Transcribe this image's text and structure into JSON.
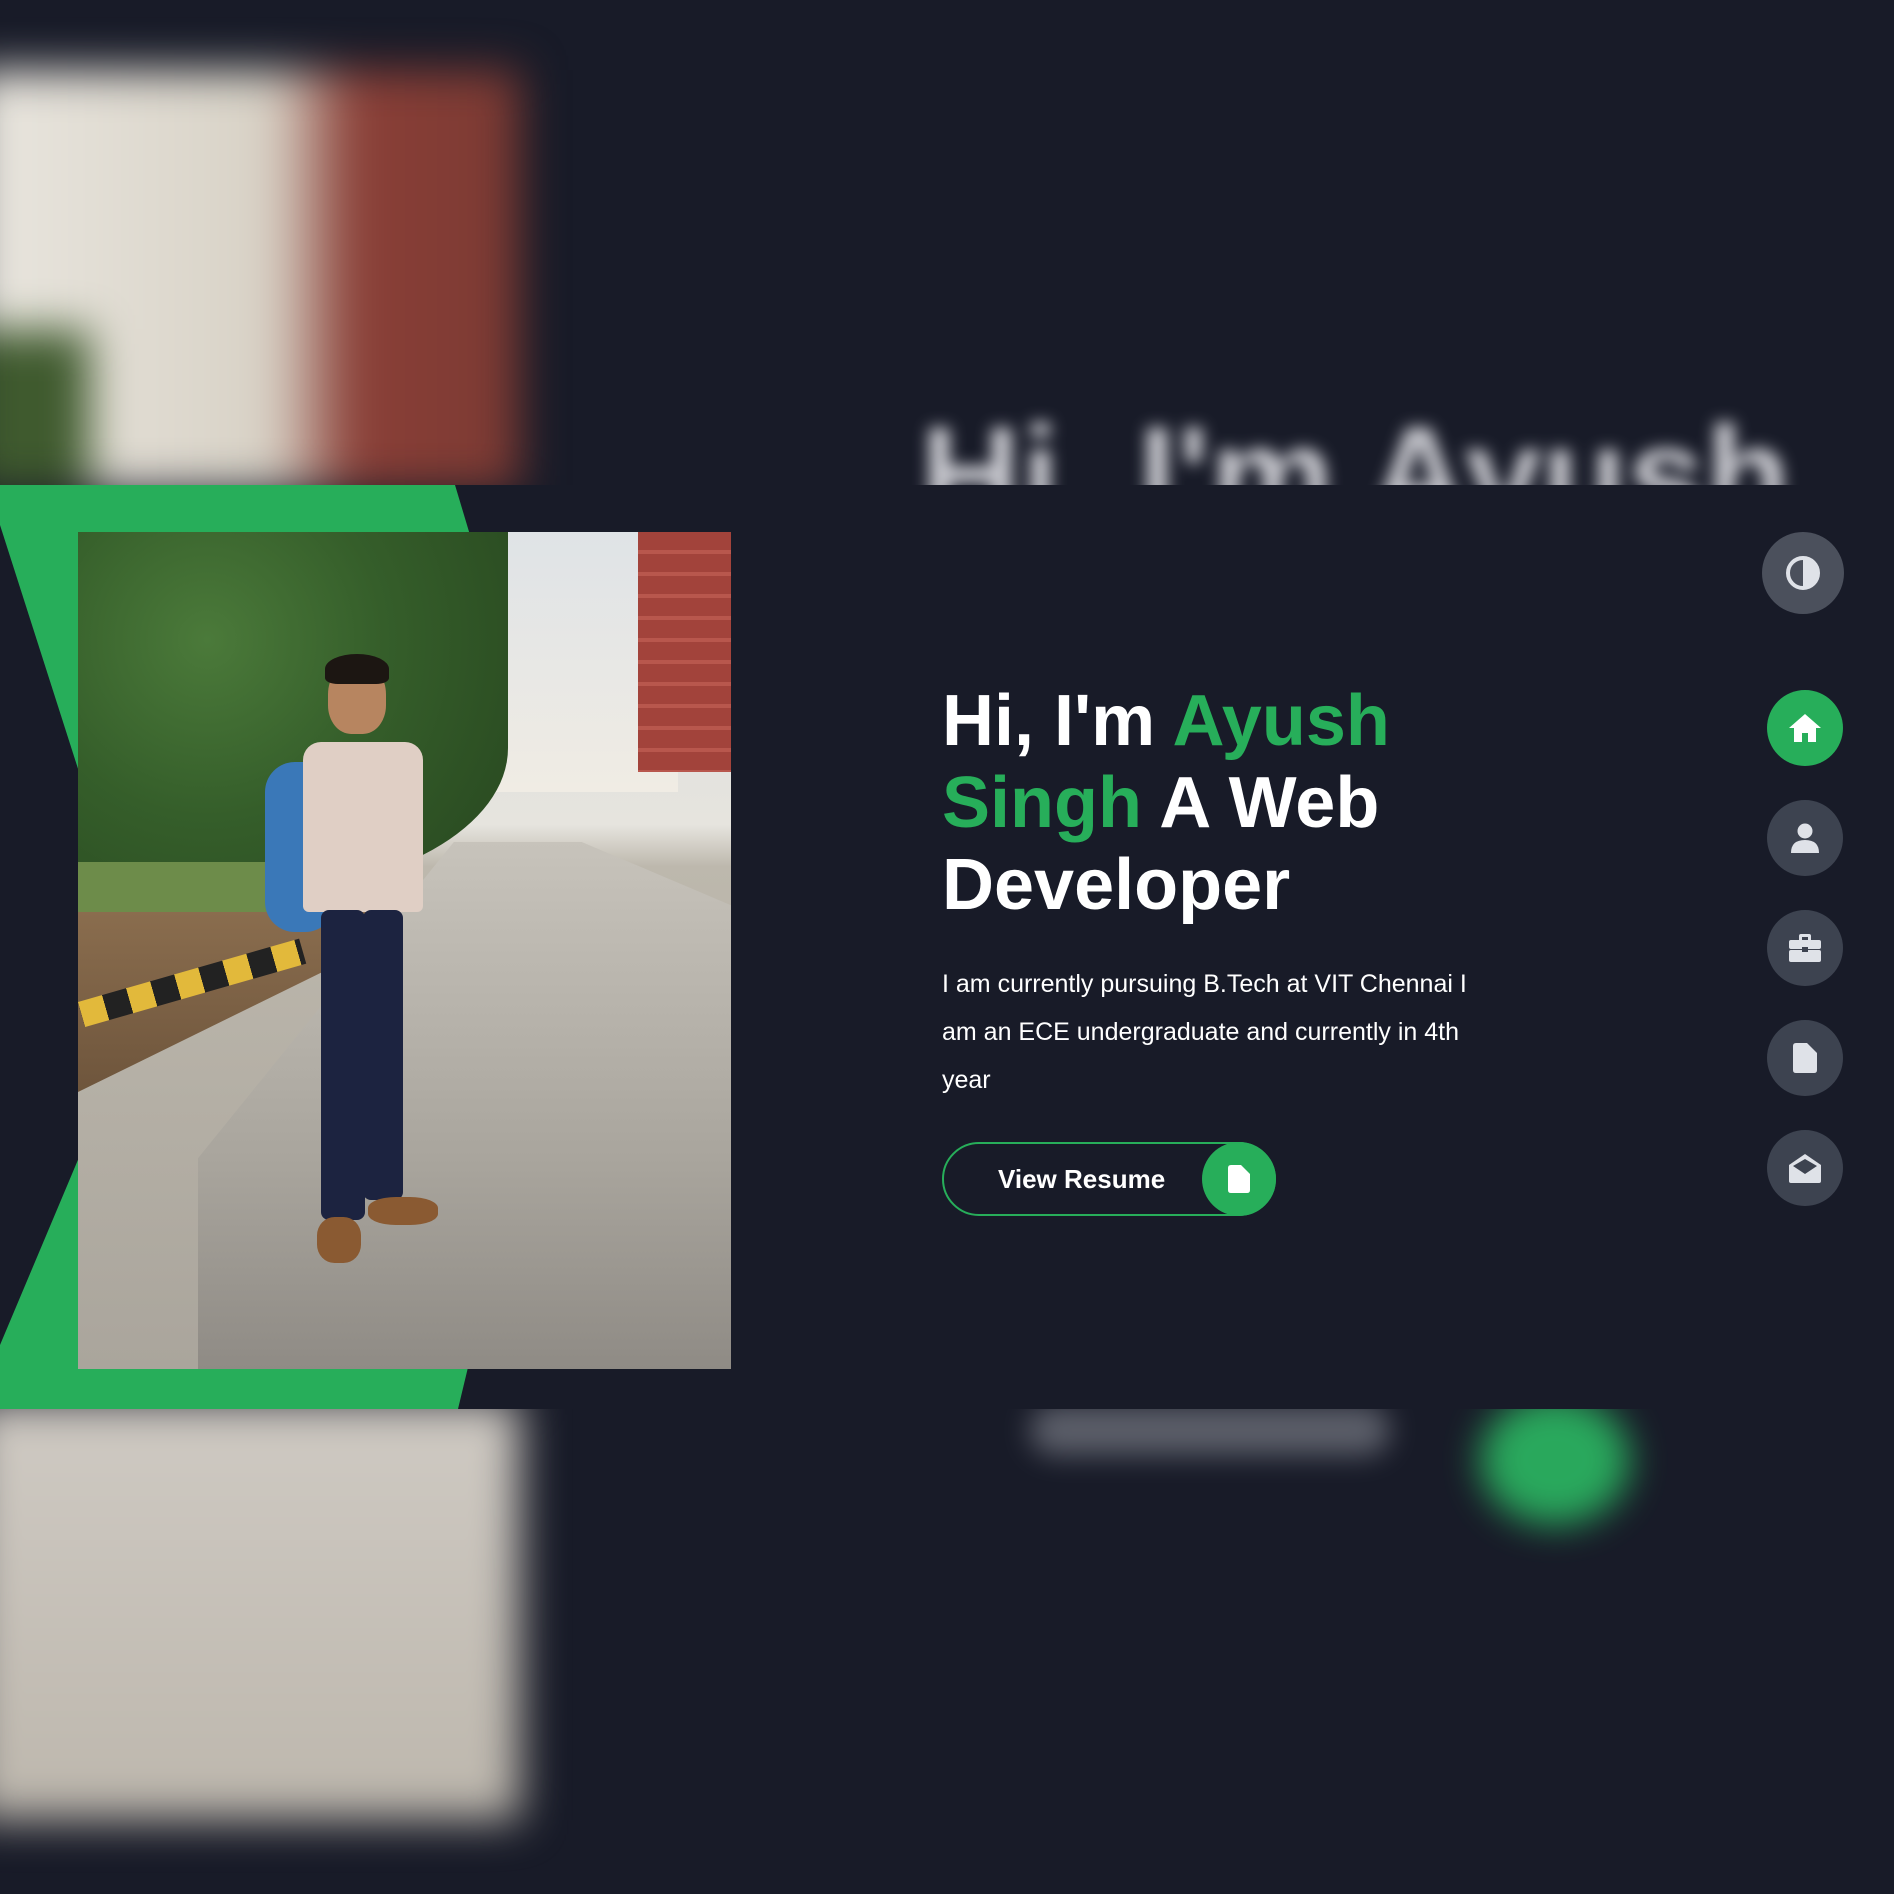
{
  "hero": {
    "greeting": "Hi, I'm ",
    "name_first": "Ayush",
    "name_last": "Singh",
    "role": " A Web Developer",
    "description": "I am currently pursuing B.Tech at VIT Chennai I am an ECE undergraduate and currently in 4th year",
    "resume_button_label": "View Resume",
    "resume_button_icon": "file-icon"
  },
  "backdrop": {
    "heading_blurred": "Hi, I'm Ayush"
  },
  "nav": {
    "theme_toggle_icon": "contrast-icon",
    "items": [
      {
        "name": "home",
        "icon": "home-icon",
        "active": true
      },
      {
        "name": "about",
        "icon": "user-icon",
        "active": false
      },
      {
        "name": "work",
        "icon": "briefcase-icon",
        "active": false
      },
      {
        "name": "resume",
        "icon": "file-icon",
        "active": false
      },
      {
        "name": "contact",
        "icon": "envelope-open-icon",
        "active": false
      }
    ]
  },
  "colors": {
    "background": "#181b28",
    "accent": "#27ae5a",
    "text": "#ffffff",
    "nav_button": "#3d4350",
    "toggle_button": "#4b505c",
    "icon": "#dfe2e8"
  }
}
